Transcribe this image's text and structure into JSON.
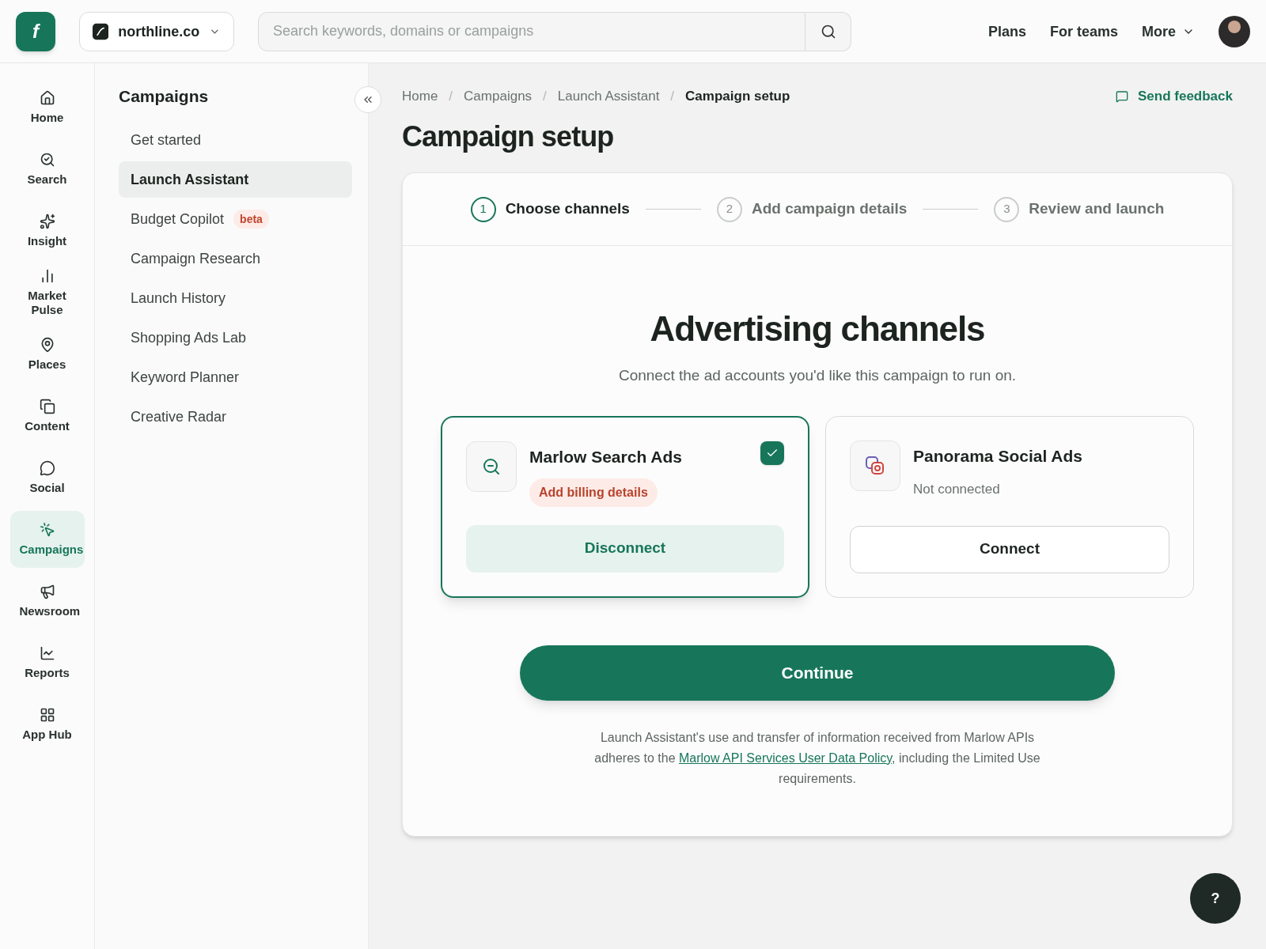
{
  "topbar": {
    "logo_glyph": "f",
    "workspace": "northline.co",
    "search": {
      "placeholder": "Search keywords, domains or campaigns"
    },
    "links": [
      {
        "label": "Plans",
        "dropdown": false
      },
      {
        "label": "For teams",
        "dropdown": false
      },
      {
        "label": "More",
        "dropdown": true
      }
    ]
  },
  "rail": [
    {
      "label": "Home",
      "selected": false
    },
    {
      "label": "Search",
      "selected": false
    },
    {
      "label": "Insight",
      "selected": false
    },
    {
      "label": "Market Pulse",
      "selected": false
    },
    {
      "label": "Places",
      "selected": false
    },
    {
      "label": "Content",
      "selected": false
    },
    {
      "label": "Social",
      "selected": false
    },
    {
      "label": "Campaigns",
      "selected": true
    },
    {
      "label": "Newsroom",
      "selected": false
    },
    {
      "label": "Reports",
      "selected": false
    },
    {
      "label": "App Hub",
      "selected": false
    }
  ],
  "sidebar": {
    "title": "Campaigns",
    "items": [
      {
        "label": "Get started",
        "selected": false
      },
      {
        "label": "Launch Assistant",
        "selected": true
      },
      {
        "label": "Budget Copilot",
        "selected": false,
        "badge": "beta"
      },
      {
        "label": "Campaign Research",
        "selected": false
      },
      {
        "label": "Launch History",
        "selected": false
      },
      {
        "label": "Shopping Ads Lab",
        "selected": false
      },
      {
        "label": "Keyword Planner",
        "selected": false
      },
      {
        "label": "Creative Radar",
        "selected": false
      }
    ]
  },
  "breadcrumbs": [
    "Home",
    "/",
    "Campaigns",
    "/",
    "Launch Assistant",
    "/",
    "Campaign setup"
  ],
  "feedback": "Send feedback",
  "title": "Campaign setup",
  "steps": [
    {
      "number": "1",
      "label": "Choose channels",
      "selected": true
    },
    {
      "number": "2",
      "label": "Add campaign details",
      "selected": false
    },
    {
      "number": "3",
      "label": "Review and launch",
      "selected": false
    }
  ],
  "heading": "Advertising channels",
  "subheading": "Connect the ad accounts you'd like this campaign to run on.",
  "channels": [
    {
      "name": "Marlow Search Ads",
      "checked": true,
      "connected": true,
      "status": "Add billing details",
      "button": "Disconnect"
    },
    {
      "name": "Panorama Social Ads",
      "checked": false,
      "connected": false,
      "status": "Not connected",
      "button": "Connect"
    }
  ],
  "continue": "Continue",
  "legal": {
    "before": "Launch Assistant's use and transfer of information received from Marlow APIs adheres to the ",
    "link": "Marlow API Services User Data Policy",
    "after": ", including the Limited Use requirements."
  },
  "help": "?"
}
